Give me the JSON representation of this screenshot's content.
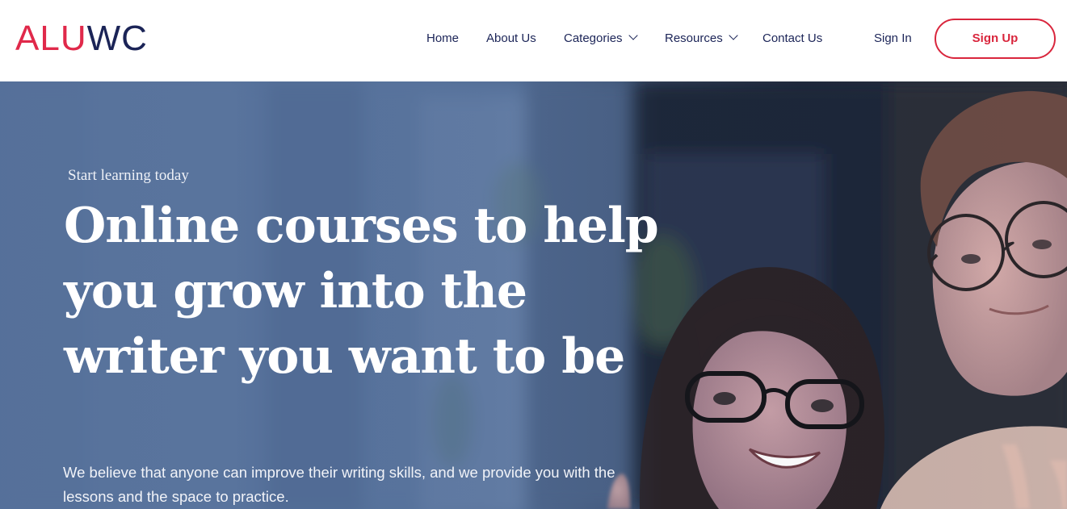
{
  "brand": {
    "logo_part_a": "ALU",
    "logo_part_b": "WC",
    "accent_red": "#d9263d",
    "navy": "#1b2457"
  },
  "nav": {
    "home": "Home",
    "about": "About Us",
    "categories": "Categories",
    "resources": "Resources",
    "contact": "Contact Us",
    "sign_in": "Sign In",
    "sign_up": "Sign Up"
  },
  "hero": {
    "eyebrow": "Start learning today",
    "title": "Online courses to help you grow into the writer you want to be",
    "subtitle": "We believe that anyone can improve their writing skills, and we provide you with the lessons and the space to practice."
  },
  "icons": {
    "categories_dropdown": "chevron-down-icon",
    "resources_dropdown": "chevron-down-icon"
  }
}
